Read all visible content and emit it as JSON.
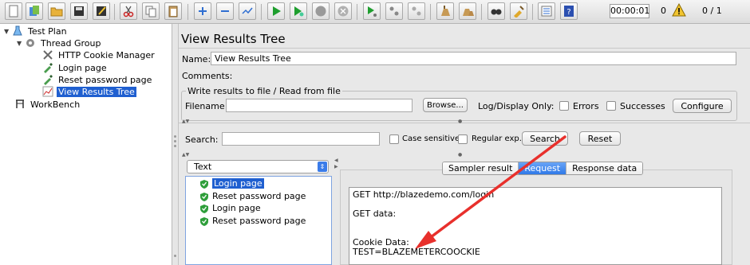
{
  "toolbar": {
    "timer": "00:00:01",
    "error_count": "0",
    "threads": "0 / 1",
    "icons": [
      "new-icon",
      "templates-icon",
      "open-icon",
      "save-icon",
      "save-as-icon",
      "cut-icon",
      "copy-icon",
      "paste-icon",
      "expand-icon",
      "collapse-icon",
      "toggle-icon",
      "start-icon",
      "start-no-pause-icon",
      "stop-icon",
      "shutdown-icon",
      "remote-start-icon",
      "remote-stop-icon",
      "remote-shutdown-icon",
      "clear-icon",
      "clear-all-icon",
      "search-icon",
      "reset-search-icon",
      "function-helper-icon",
      "help-icon",
      "warning-icon"
    ]
  },
  "tree": {
    "items": [
      {
        "label": "Test Plan",
        "icon": "test-plan-icon"
      },
      {
        "label": "Thread Group",
        "icon": "gear-icon"
      },
      {
        "label": "HTTP Cookie Manager",
        "icon": "tools-icon"
      },
      {
        "label": "Login page",
        "icon": "pipette-icon"
      },
      {
        "label": "Reset password page",
        "icon": "pipette-icon"
      },
      {
        "label": "View Results Tree",
        "icon": "chart-icon"
      },
      {
        "label": "WorkBench",
        "icon": "workbench-icon"
      }
    ],
    "selected": "View Results Tree"
  },
  "panel": {
    "title": "View Results Tree",
    "name_label": "Name:",
    "name_value": "View Results Tree",
    "comments_label": "Comments:",
    "file_group_legend": "Write results to file / Read from file",
    "filename_label": "Filename",
    "browse_label": "Browse...",
    "log_display_label": "Log/Display Only:",
    "errors_label": "Errors",
    "successes_label": "Successes",
    "configure_label": "Configure",
    "search_label": "Search:",
    "case_sensitive_label": "Case sensitive",
    "regex_label": "Regular exp.",
    "search_button": "Search",
    "reset_button": "Reset"
  },
  "results": {
    "renderer": "Text",
    "items": [
      "Login page",
      "Reset password page",
      "Login page",
      "Reset password page"
    ],
    "selected_index": 0
  },
  "tabs": [
    "Sampler result",
    "Request",
    "Response data"
  ],
  "active_tab": "Request",
  "request_text": [
    "GET http://blazedemo.com/login",
    "",
    "GET data:",
    "",
    "",
    "Cookie Data:",
    "TEST=BLAZEMETERCOOCKIE"
  ],
  "colors": {
    "selection": "#1f5fd0",
    "annotation_arrow": "#e8302c",
    "success_shield": "#2e9e3a"
  }
}
